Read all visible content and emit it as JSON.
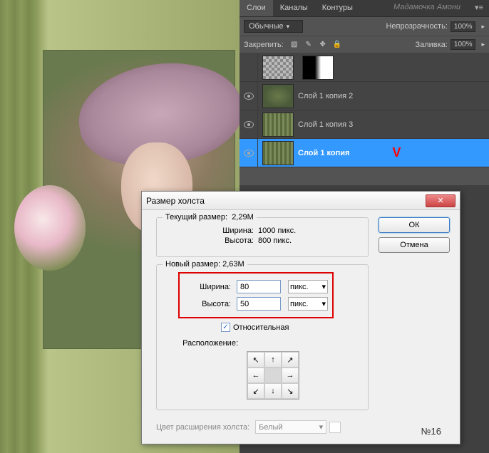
{
  "layers_panel": {
    "tabs": {
      "layers": "Слои",
      "channels": "Каналы",
      "paths": "Контуры"
    },
    "watermark": "Мадамочка Амони",
    "blend_mode": "Обычные",
    "opacity_label": "Непрозрачность:",
    "opacity_value": "100%",
    "lock_label": "Закрепить:",
    "fill_label": "Заливка:",
    "fill_value": "100%",
    "layers": [
      {
        "name": ""
      },
      {
        "name": "Слой 1 копия 2"
      },
      {
        "name": "Слой 1 копия 3"
      },
      {
        "name": "Слой 1 копия",
        "selected": true,
        "mark": "V"
      }
    ]
  },
  "dialog": {
    "title": "Размер холста",
    "close_glyph": "✕",
    "ok": "ОК",
    "cancel": "Отмена",
    "current": {
      "legend": "Текущий размер:",
      "size": "2,29M",
      "width_label": "Ширина:",
      "width_value": "1000 пикс.",
      "height_label": "Высота:",
      "height_value": "800 пикс."
    },
    "new": {
      "legend": "Новый размер:",
      "size": "2,63M",
      "width_label": "Ширина:",
      "width_value": "80",
      "height_label": "Высота:",
      "height_value": "50",
      "unit": "пикс.",
      "relative_label": "Относительная",
      "anchor_label": "Расположение:"
    },
    "extension": {
      "label": "Цвет расширения холста:",
      "value": "Белый"
    }
  },
  "page_number": "№16",
  "arrows": {
    "nw": "↖",
    "n": "↑",
    "ne": "↗",
    "w": "←",
    "e": "→",
    "sw": "↙",
    "s": "↓",
    "se": "↘"
  }
}
